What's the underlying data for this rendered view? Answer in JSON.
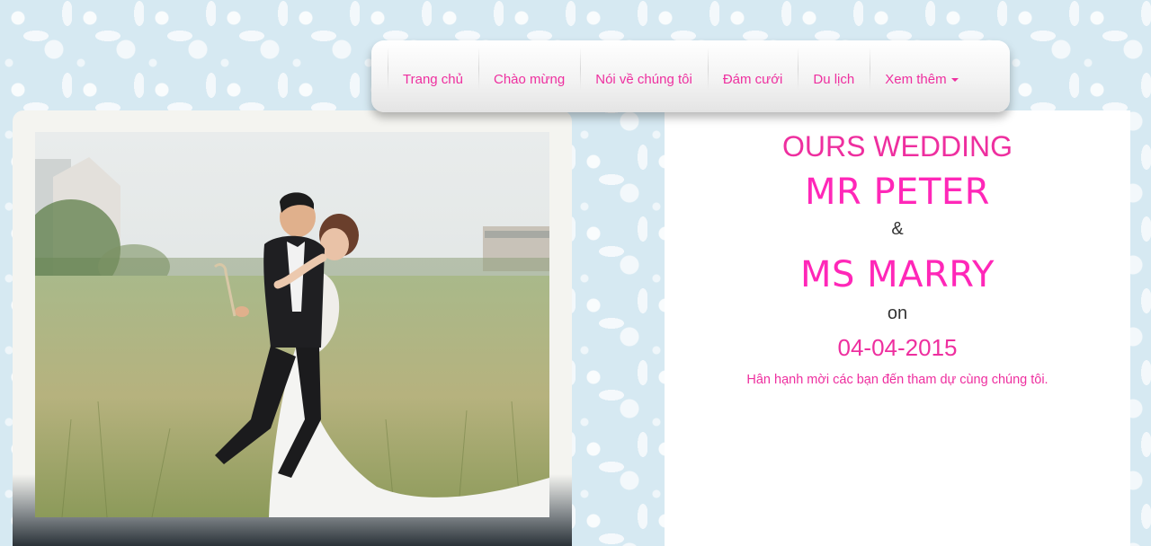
{
  "nav": {
    "items": [
      {
        "label": "Trang chủ"
      },
      {
        "label": "Chào mừng"
      },
      {
        "label": "Nói về chúng tôi"
      },
      {
        "label": "Đám cưới"
      },
      {
        "label": "Du lịch"
      },
      {
        "label": "Xem thêm",
        "icon": "caret-down-icon"
      }
    ]
  },
  "invitation": {
    "title": "OURS WEDDING",
    "groom": "MR PETER",
    "ampersand": "&",
    "bride": "MS MARRY",
    "on": "on",
    "date": "04-04-2015",
    "message": "Hân hạnh mời các bạn đến tham dự cùng chúng tôi."
  },
  "colors": {
    "accent": "#ee2f9f",
    "name_pink": "#ff27b8",
    "background": "#d6e9f2"
  }
}
